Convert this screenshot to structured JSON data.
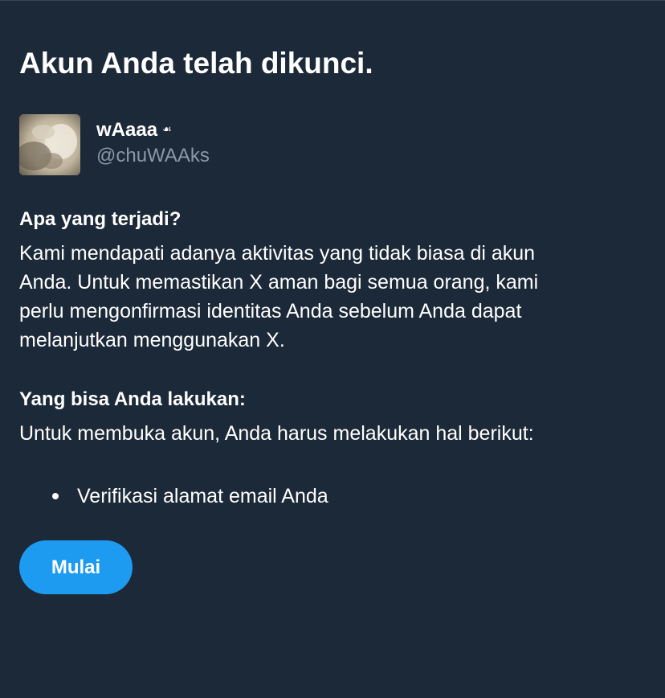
{
  "page": {
    "title": "Akun Anda telah dikunci."
  },
  "account": {
    "display_name": "wAaaa",
    "name_emoji": "☙",
    "handle": "@chuWAAks",
    "avatar_icon": "user-avatar-photo"
  },
  "what_happened": {
    "heading": "Apa yang terjadi?",
    "lines": [
      "Kami mendapati adanya aktivitas yang tidak biasa di akun",
      "Anda. Untuk memastikan X aman bagi semua orang, kami",
      "perlu mengonfirmasi identitas Anda sebelum Anda dapat",
      "melanjutkan menggunakan X."
    ]
  },
  "what_you_can_do": {
    "heading": "Yang bisa Anda lakukan:",
    "body": "Untuk membuka akun, Anda harus melakukan hal berikut:",
    "steps": [
      "Verifikasi alamat email Anda"
    ]
  },
  "actions": {
    "start_label": "Mulai"
  },
  "colors": {
    "background": "#1c2938",
    "text": "#ffffff",
    "secondary_text": "#8b98a5",
    "accent": "#1d9bf0"
  }
}
